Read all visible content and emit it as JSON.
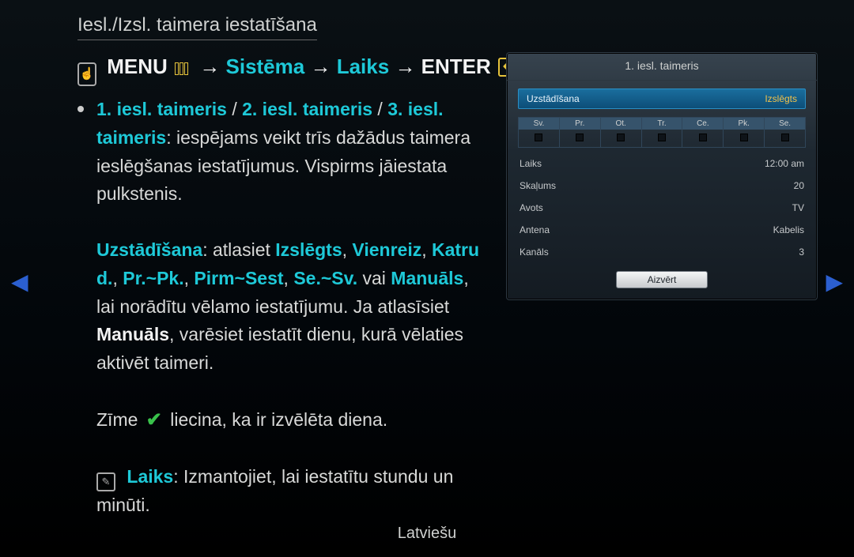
{
  "title": "Iesl./Izsl. taimera iestatīšana",
  "breadcrumb": {
    "menu": "MENU",
    "sys": "Sistēma",
    "time": "Laiks",
    "enter": "ENTER",
    "arrow": "→"
  },
  "bullets": {
    "timers": {
      "t1": "1. iesl. taimeris",
      "t2": "2. iesl. taimeris",
      "t3": "3. iesl. taimeris",
      "sep": " / ",
      "rest": ": iespējams veikt trīs dažādus taimera ieslēgšanas iestatījumus. Vispirms jāiestata pulkstenis."
    },
    "setup": {
      "lead": "Uzstādīšana",
      "mid1": ": atlasiet ",
      "v_off": "Izslēgts",
      "v_once": "Vienreiz",
      "v_daily": "Katru d.",
      "v_monfri": "Pr.~Pk.",
      "v_monsat": "Pirm~Sest",
      "v_satsun": "Se.~Sv.",
      "mid2": " vai ",
      "v_manual": "Manuāls",
      "mid3": ", lai norādītu vēlamo iestatījumu. Ja atlasīsiet ",
      "v_manual2": "Manuāls",
      "mid4": ", varēsiet iestatīt dienu, kurā vēlaties aktivēt taimeri."
    },
    "mark": {
      "pre": "Zīme",
      "post": "liecina, ka ir izvēlēta diena."
    },
    "time_note": {
      "lead": "Laiks",
      "rest": ": Izmantojiet, lai iestatītu stundu un minūti."
    }
  },
  "panel": {
    "title": "1. iesl. taimeris",
    "row_setup_label": "Uzstādīšana",
    "row_setup_value": "Izslēgts",
    "days": [
      "Sv.",
      "Pr.",
      "Ot.",
      "Tr.",
      "Ce.",
      "Pk.",
      "Se."
    ],
    "rows": [
      {
        "label": "Laiks",
        "value": "12:00 am"
      },
      {
        "label": "Skaļums",
        "value": "20"
      },
      {
        "label": "Avots",
        "value": "TV"
      },
      {
        "label": "Antena",
        "value": "Kabelis"
      },
      {
        "label": "Kanāls",
        "value": "3"
      }
    ],
    "close": "Aizvērt"
  },
  "footer": "Latviešu"
}
